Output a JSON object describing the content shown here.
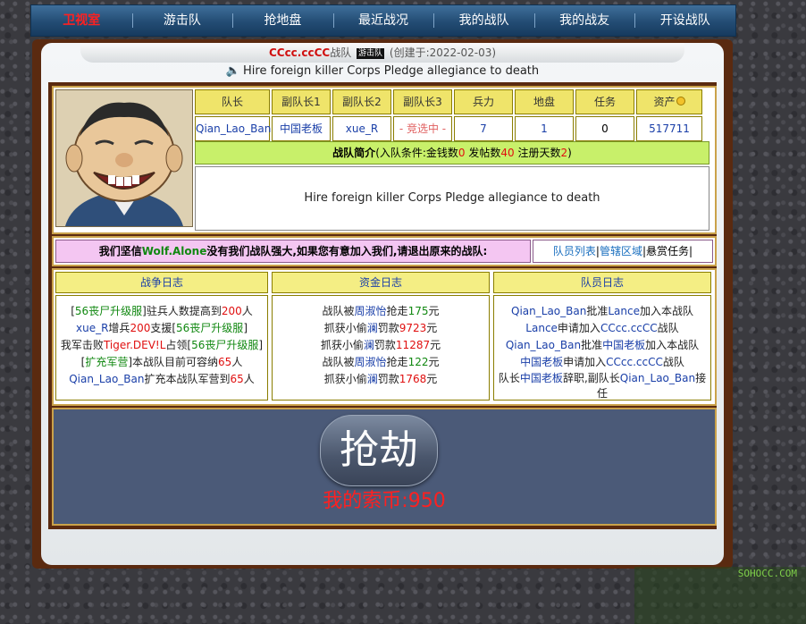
{
  "nav": {
    "items": [
      {
        "label": "卫视室"
      },
      {
        "label": "游击队"
      },
      {
        "label": "抢地盘"
      },
      {
        "label": "最近战况"
      },
      {
        "label": "我的战队"
      },
      {
        "label": "我的战友"
      },
      {
        "label": "开设战队"
      }
    ]
  },
  "header": {
    "team_name": "CCcc.ccCC",
    "team_suffix": "战队",
    "tag": "游击队",
    "created": "(创建于:2022-02-03)"
  },
  "slogan": "Hire foreign killer Corps Pledge allegiance to death",
  "stats": {
    "headers": [
      "队长",
      "副队长1",
      "副队长2",
      "副队长3",
      "兵力",
      "地盘",
      "任务",
      "资产"
    ],
    "values": [
      "Qian_Lao_Ban",
      "中国老板",
      "xue_R",
      "- 竞选中 -",
      "7",
      "1",
      "0",
      "517711"
    ]
  },
  "intro": {
    "label": "战队简介",
    "cond_prefix": "(入队条件:金钱数",
    "money": "0",
    "posts_label": " 发帖数",
    "posts": "40",
    "days_label": " 注册天数",
    "days": "2",
    "cond_suffix": ")",
    "text": "Hire foreign killer Corps Pledge allegiance to death"
  },
  "recruit": {
    "prefix": "我们坚信",
    "team": "Wolf.Alone",
    "suffix": "没有我们战队强大,如果您有意加入我们,请退出原来的战队:",
    "link_members": "队员列表",
    "sep1": "|",
    "link_area": "管辖区域",
    "sep2": "|",
    "bounty": "悬赏任务|"
  },
  "logs": {
    "war": {
      "title": "战争日志",
      "lines": [
        [
          "[",
          "56丧尸升级服",
          "]驻兵人数提高到",
          "200",
          "人"
        ],
        [
          "xue_R",
          "增兵",
          "200",
          "支援[",
          "56丧尸升级服",
          "]"
        ],
        [
          "我军击败",
          "Tiger.DEV!L",
          "占领[",
          "56丧尸升级服",
          "]"
        ],
        [
          "[",
          "扩充军营",
          "]本战队目前可容纳",
          "65",
          "人"
        ],
        [
          "Qian_Lao_Ban",
          "扩充本战队军营到",
          "65",
          "人"
        ]
      ]
    },
    "fund": {
      "title": "资金日志",
      "lines": [
        [
          "战队被",
          "周淑怡",
          "抢走",
          "175",
          "元"
        ],
        [
          "抓获小偷",
          "澜",
          "罚款",
          "9723",
          "元"
        ],
        [
          "抓获小偷",
          "澜",
          "罚款",
          "11287",
          "元"
        ],
        [
          "战队被",
          "周淑怡",
          "抢走",
          "122",
          "元"
        ],
        [
          "抓获小偷",
          "澜",
          "罚款",
          "1768",
          "元"
        ]
      ]
    },
    "member": {
      "title": "队员日志",
      "lines": [
        [
          "Qian_Lao_Ban",
          "批准",
          "Lance",
          "加入本战队"
        ],
        [
          "Lance",
          "申请加入",
          "CCcc.ccCC",
          "战队"
        ],
        [
          "Qian_Lao_Ban",
          "批准",
          "中国老板",
          "加入本战队"
        ],
        [
          "中国老板",
          "申请加入",
          "CCcc.ccCC",
          "战队"
        ],
        [
          "队长",
          "中国老板",
          "辞职,副队长",
          "Qian_Lao_Ban",
          "接任"
        ]
      ]
    }
  },
  "rob": {
    "button": "抢劫",
    "coins": "我的索币:950"
  },
  "watermark": "SOHOCC.COM",
  "colors": {
    "nav_bg": "#234c74",
    "frame": "#5a2a10",
    "yellow_cell": "#efe46a",
    "intro_bar": "#c8f06a",
    "recruit_bar": "#f4c6f2",
    "rob_bg": "#4b5a78",
    "accent_red": "#e01010"
  }
}
